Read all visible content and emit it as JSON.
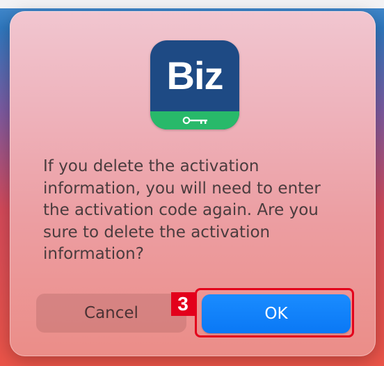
{
  "app_icon": {
    "text": "Biz",
    "icon": "key-icon",
    "colors": {
      "background": "#1e4a84",
      "band": "#28b96a"
    }
  },
  "dialog": {
    "message": "If you delete the activation information, you will need to enter the activation code again. Are you sure to delete the activation information?",
    "cancel_label": "Cancel",
    "ok_label": "OK"
  },
  "annotation": {
    "step_number": "3",
    "color": "#e3001b"
  }
}
